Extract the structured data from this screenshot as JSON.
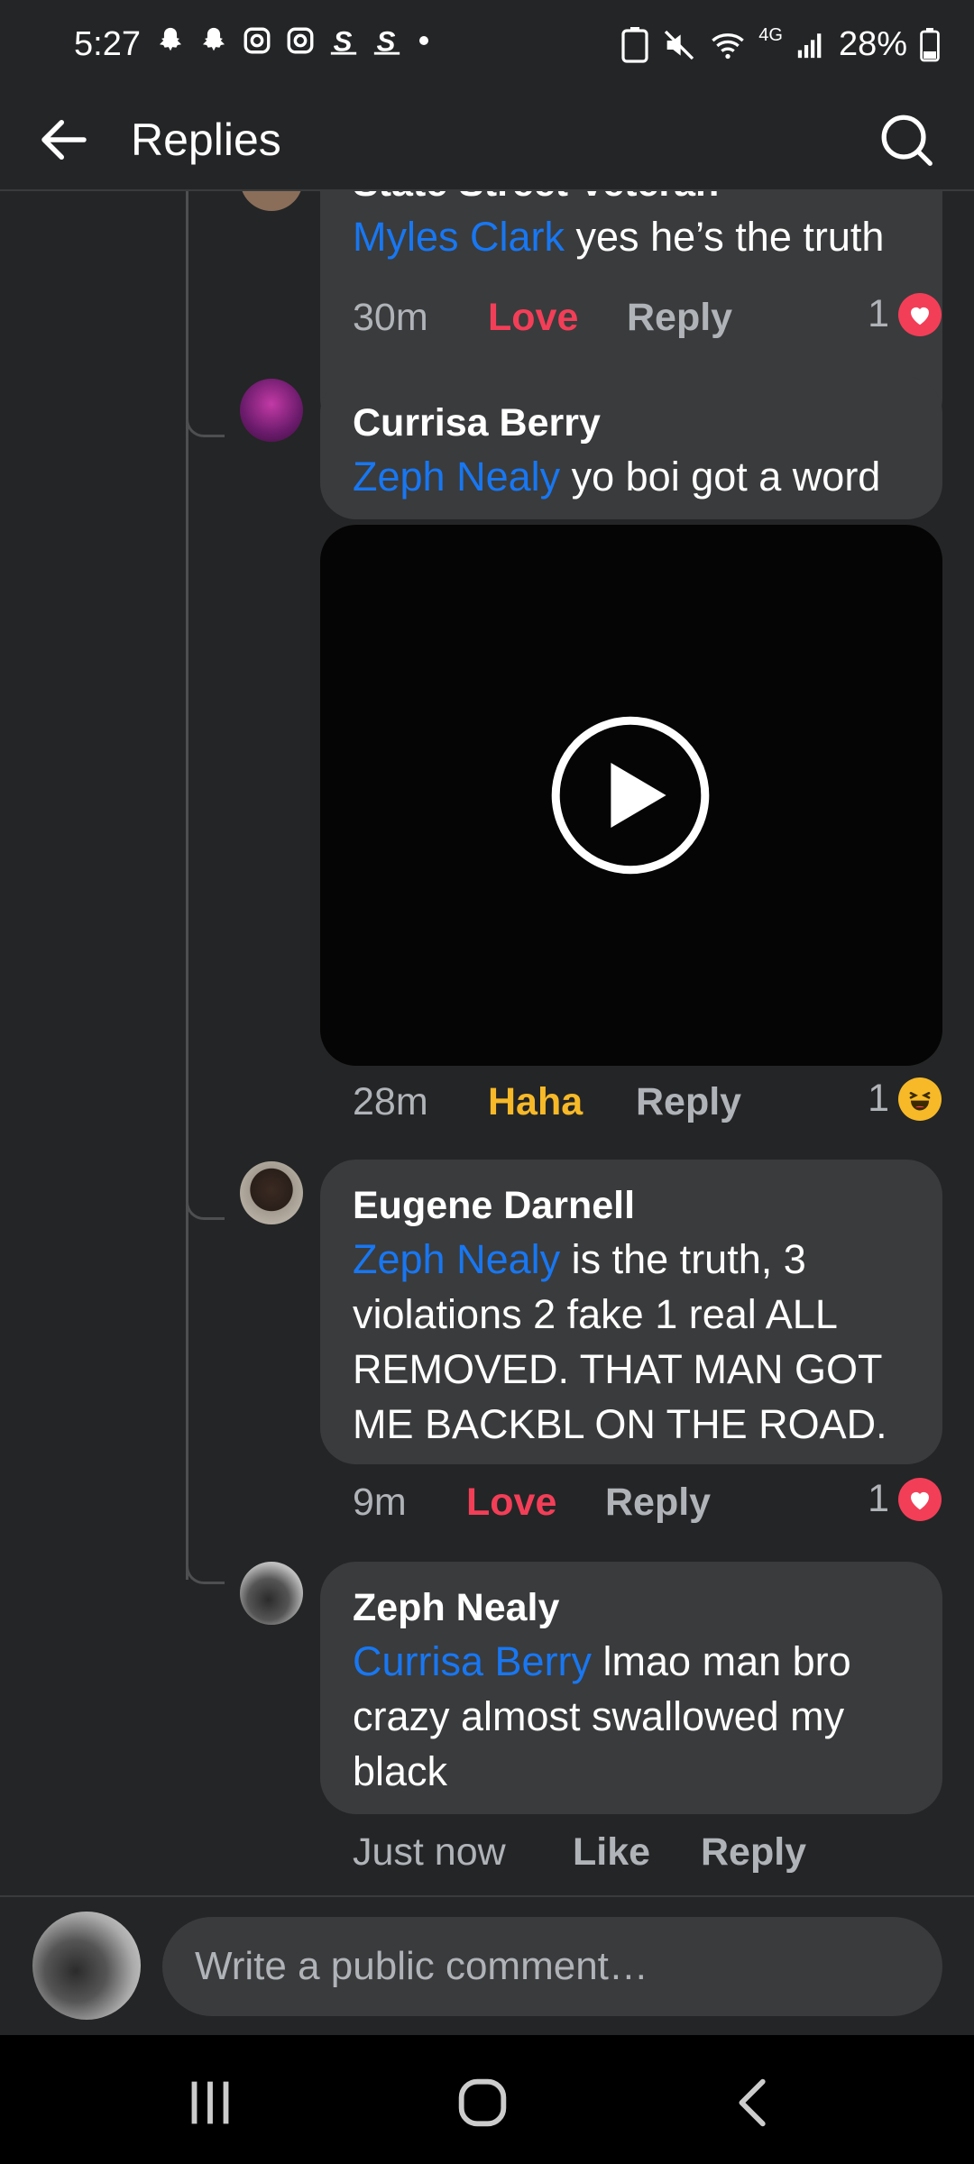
{
  "status_bar": {
    "time": "5:27",
    "notification_icons": [
      "snapchat-icon",
      "snapchat-icon",
      "instagram-icon",
      "instagram-icon",
      "cashapp-icon",
      "cashapp-icon",
      "dot-icon"
    ],
    "network": "4G",
    "battery": "28%"
  },
  "app_bar": {
    "title": "Replies"
  },
  "comments": [
    {
      "name": "State Street Veteran",
      "mention": "Myles Clark",
      "text": " yes he’s the truth",
      "time": "30m",
      "reaction_label": "Love",
      "reply_label": "Reply",
      "reaction_count": "1",
      "reaction_color": "#f33e58"
    },
    {
      "name": "Currisa Berry",
      "mention": "Zeph Nealy",
      "text": " yo boi got a word",
      "time": "28m",
      "reaction_label": "Haha",
      "reply_label": "Reply",
      "reaction_count": "1",
      "reaction_color": "#f7b928",
      "has_video": true
    },
    {
      "name": "Eugene Darnell",
      "mention": "Zeph Nealy",
      "text": "  is the truth,  3 violations  2 fake 1 real ALL REMOVED. THAT MAN GOT ME BACKBL ON THE ROAD.",
      "time": "9m",
      "reaction_label": "Love",
      "reply_label": "Reply",
      "reaction_count": "1",
      "reaction_color": "#f33e58"
    },
    {
      "name": "Zeph Nealy",
      "mention": "Currisa Berry",
      "text": " lmao man bro crazy almost swallowed my black",
      "time": "Just now",
      "reaction_label": "Like",
      "reply_label": "Reply"
    }
  ],
  "composer": {
    "placeholder": "Write a public comment…"
  },
  "colors": {
    "background": "#242526",
    "bubble": "#3a3b3c",
    "mention": "#1877f2"
  }
}
